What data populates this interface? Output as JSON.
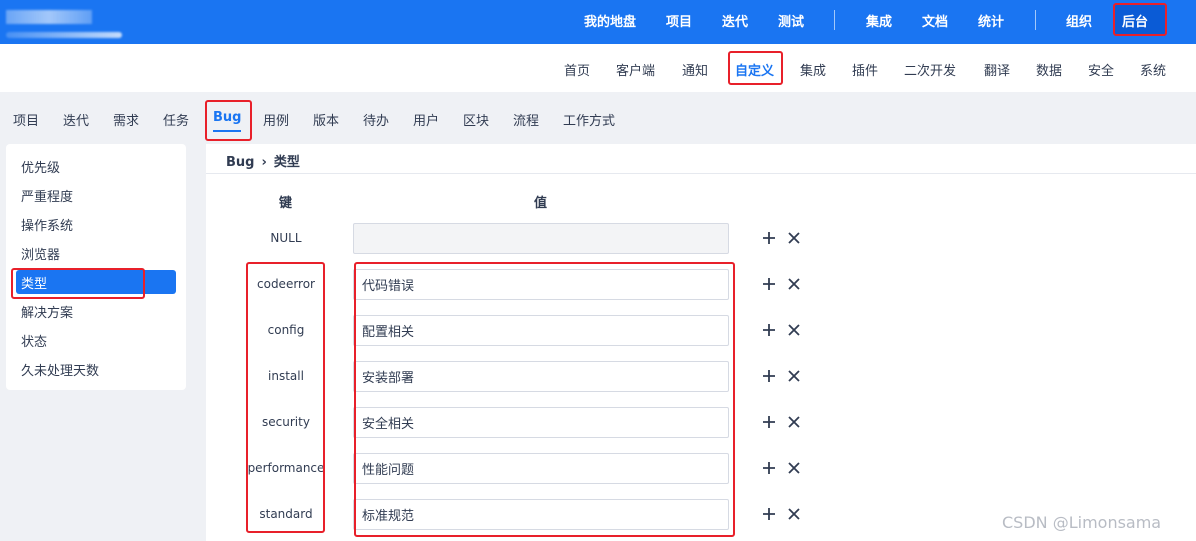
{
  "topnav": {
    "items": [
      "我的地盘",
      "项目",
      "迭代",
      "测试"
    ],
    "items2": [
      "集成",
      "文档",
      "统计"
    ],
    "items3": [
      "组织",
      "后台"
    ]
  },
  "subnav": {
    "items": [
      "首页",
      "客户端",
      "通知",
      "自定义",
      "集成",
      "插件",
      "二次开发",
      "翻译",
      "数据",
      "安全",
      "系统"
    ],
    "active": "自定义"
  },
  "tabs": {
    "items": [
      "项目",
      "迭代",
      "需求",
      "任务",
      "Bug",
      "用例",
      "版本",
      "待办",
      "用户",
      "区块",
      "流程",
      "工作方式"
    ],
    "active": "Bug"
  },
  "sidebar": {
    "items": [
      "优先级",
      "严重程度",
      "操作系统",
      "浏览器",
      "类型",
      "解决方案",
      "状态",
      "久未处理天数"
    ],
    "active": "类型"
  },
  "breadcrumb": {
    "root": "Bug",
    "current": "类型"
  },
  "table": {
    "key_header": "键",
    "value_header": "值",
    "rows": [
      {
        "key": "NULL",
        "value": ""
      },
      {
        "key": "codeerror",
        "value": "代码错误"
      },
      {
        "key": "config",
        "value": "配置相关"
      },
      {
        "key": "install",
        "value": "安装部署"
      },
      {
        "key": "security",
        "value": "安全相关"
      },
      {
        "key": "performance",
        "value": "性能问题"
      },
      {
        "key": "standard",
        "value": "标准规范"
      }
    ]
  },
  "icons": {
    "add": "plus-icon",
    "delete": "close-icon"
  },
  "watermark": "CSDN @Limonsama",
  "colors": {
    "primary": "#1a75f2",
    "highlight": "#e8202a"
  }
}
